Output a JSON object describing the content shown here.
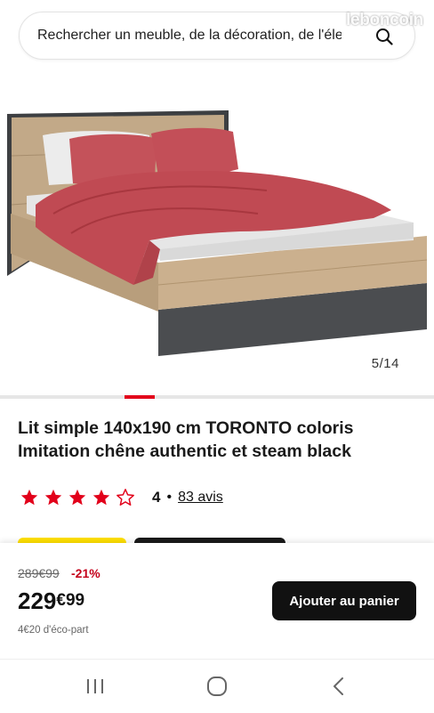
{
  "search": {
    "placeholder": "Rechercher un meuble, de la décoration, de l'élec",
    "icon": "search-icon"
  },
  "watermark": "leboncoin",
  "gallery": {
    "counter": "5/14",
    "current": 5,
    "total": 14
  },
  "product": {
    "title": "Lit simple 140x190 cm TORONTO coloris Imitation chêne authentic et steam black",
    "rating": {
      "stars": 4,
      "max": 5,
      "value": "4",
      "separator": "•",
      "reviews_label": "83 avis",
      "star_color": "#e2001a"
    }
  },
  "pricing": {
    "old_price": "289€99",
    "discount": "-21%",
    "price_main": "229",
    "price_cents": "€99",
    "eco_part": "4€20 d'éco-part",
    "add_to_cart": "Ajouter au panier"
  },
  "colors": {
    "accent": "#e2001a",
    "button": "#111111",
    "badge_yellow": "#ffe000"
  },
  "nav": {
    "buttons": [
      "recent-apps-icon",
      "home-icon",
      "back-icon"
    ]
  }
}
